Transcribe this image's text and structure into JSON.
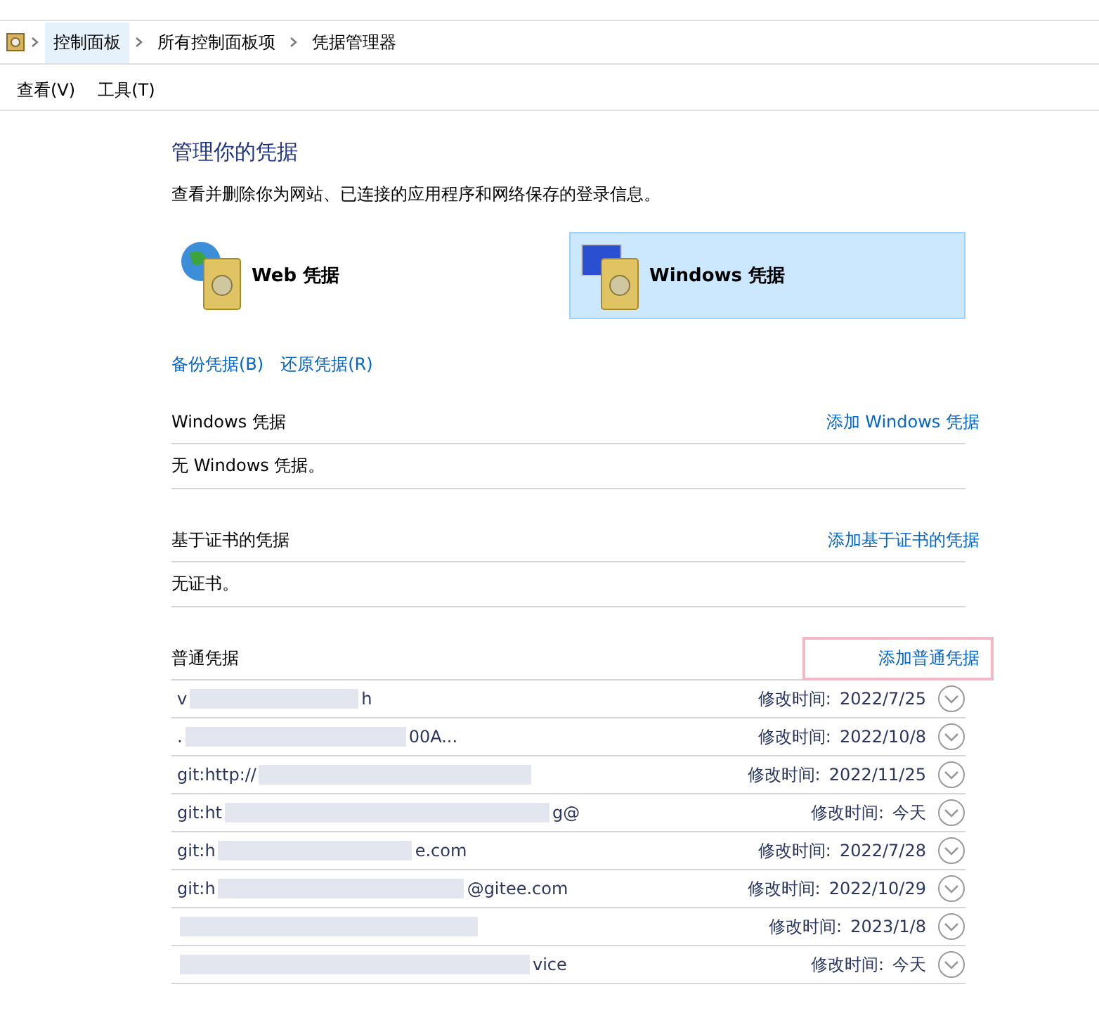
{
  "breadcrumb": [
    "控制面板",
    "所有控制面板项",
    "凭据管理器"
  ],
  "menu": [
    "查看(V)",
    "工具(T)"
  ],
  "title": "管理你的凭据",
  "description": "查看并删除你为网站、已连接的应用程序和网络保存的登录信息。",
  "vaults": [
    {
      "kind": "web",
      "label": "Web 凭据",
      "selected": false
    },
    {
      "kind": "windows",
      "label": "Windows 凭据",
      "selected": true
    }
  ],
  "actions": [
    "备份凭据(B)",
    "还原凭据(R)"
  ],
  "sections": [
    {
      "heading": "Windows 凭据",
      "add_link": "添加 Windows 凭据",
      "highlighted": false,
      "empty_text": "无 Windows 凭据。"
    },
    {
      "heading": "基于证书的凭据",
      "add_link": "添加基于证书的凭据",
      "highlighted": false,
      "empty_text": "无证书。"
    },
    {
      "heading": "普通凭据",
      "add_link": "添加普通凭据",
      "highlighted": true,
      "entries": [
        {
          "name_start": "v",
          "name_end": "h",
          "modified_label": "修改时间:",
          "modified": "2022/7/25"
        },
        {
          "name_start": ".",
          "name_end": "00A...",
          "modified_label": "修改时间:",
          "modified": "2022/10/8"
        },
        {
          "name_start": "git:http://",
          "modified_label": "修改时间:",
          "modified": "2022/11/25"
        },
        {
          "name_start": "git:ht",
          "name_end": "g@",
          "modified_label": "修改时间:",
          "modified": "今天"
        },
        {
          "name_start": "git:h",
          "name_end": "e.com",
          "modified_label": "修改时间:",
          "modified": "2022/7/28"
        },
        {
          "name_start": "git:h",
          "name_end": "@gitee.com",
          "modified_label": "修改时间:",
          "modified": "2022/10/29"
        },
        {
          "modified_label": "修改时间:",
          "modified": "2023/1/8"
        },
        {
          "name_end": "vice",
          "modified_label": "修改时间:",
          "modified": "今天"
        }
      ]
    }
  ]
}
